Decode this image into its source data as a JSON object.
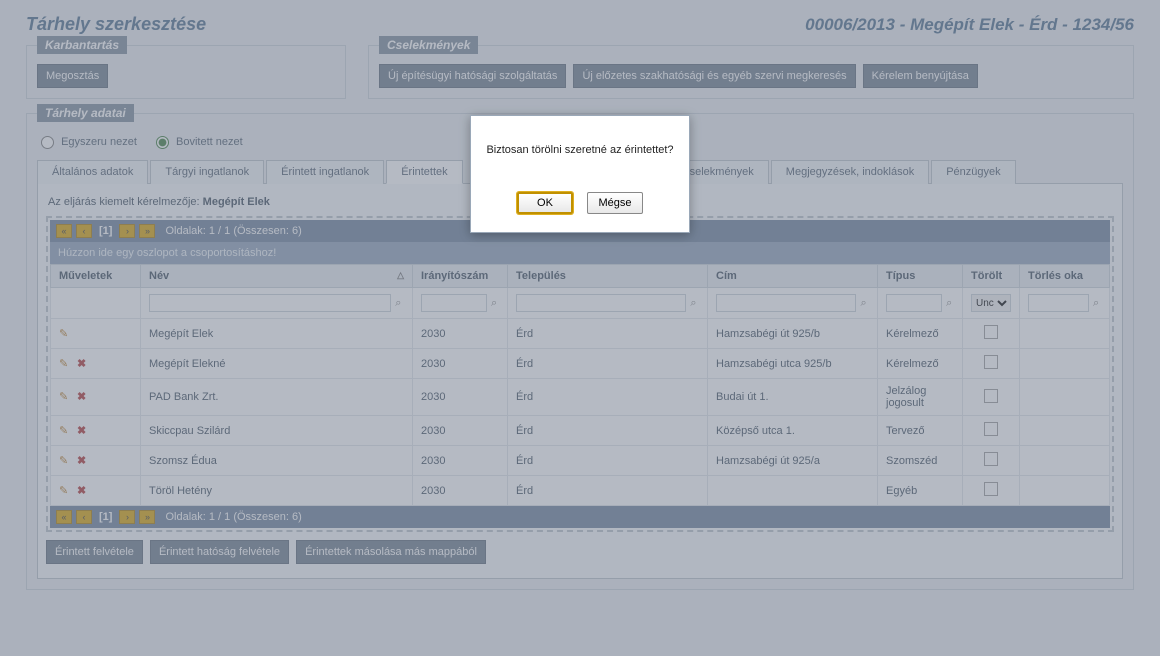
{
  "header": {
    "title": "Tárhely szerkesztése",
    "reference": "00006/2013 - Megépít Elek - Érd - 1234/56"
  },
  "sections": {
    "karbantartas": {
      "legend": "Karbantartás",
      "buttons": {
        "megosztas": "Megosztás"
      }
    },
    "cselekmenyek": {
      "legend": "Cselekmények",
      "buttons": {
        "uj_ep": "Új építésügyi hatósági szolgáltatás",
        "uj_elo": "Új előzetes szakhatósági és egyéb szervi megkeresés",
        "kerelem": "Kérelem benyújtása"
      }
    },
    "tarhely_adatai": {
      "legend": "Tárhely adatai"
    }
  },
  "view": {
    "simple": "Egyszeru nezet",
    "extended": "Bovitett nezet"
  },
  "tabs": {
    "altalanos": "Általános adatok",
    "targyi": "Tárgyi ingatlanok",
    "erintett_ing": "Érintett ingatlanok",
    "erintettek": "Érintettek",
    "cselekmenyek": "Cselekmények",
    "megj": "Megjegyzések, indoklások",
    "penzugyek": "Pénzügyek"
  },
  "kiemelt": {
    "prefix": "Az eljárás kiemelt kérelmezője: ",
    "name": "Megépít Elek"
  },
  "pager": {
    "current": "[1]",
    "text": "Oldalak: 1 / 1 (Összesen: 6)"
  },
  "group_hint": "Húzzon ide egy oszlopot a csoportosításhoz!",
  "columns": {
    "ops": "Műveletek",
    "name": "Név",
    "zip": "Irányítószám",
    "town": "Település",
    "addr": "Cím",
    "type": "Típus",
    "deleted": "Törölt",
    "reason": "Törlés oka"
  },
  "filter": {
    "unc_option": "Unc"
  },
  "rows": [
    {
      "name": "Megépít Elek",
      "zip": "2030",
      "town": "Érd",
      "addr": "Hamzsabégi út 925/b",
      "type": "Kérelmező",
      "has_delete": false
    },
    {
      "name": "Megépít Elekné",
      "zip": "2030",
      "town": "Érd",
      "addr": "Hamzsabégi utca 925/b",
      "type": "Kérelmező",
      "has_delete": true
    },
    {
      "name": "PAD Bank Zrt.",
      "zip": "2030",
      "town": "Érd",
      "addr": "Budai út 1.",
      "type": "Jelzálog jogosult",
      "has_delete": true
    },
    {
      "name": "Skiccpau Szilárd",
      "zip": "2030",
      "town": "Érd",
      "addr": "Középső utca 1.",
      "type": "Tervező",
      "has_delete": true
    },
    {
      "name": "Szomsz Édua",
      "zip": "2030",
      "town": "Érd",
      "addr": "Hamzsabégi út 925/a",
      "type": "Szomszéd",
      "has_delete": true
    },
    {
      "name": "Töröl Hetény",
      "zip": "2030",
      "town": "Érd",
      "addr": "",
      "type": "Egyéb",
      "has_delete": true
    }
  ],
  "bottom_buttons": {
    "add": "Érintett felvétele",
    "add_auth": "Érintett hatóság felvétele",
    "copy": "Érintettek másolása más mappából"
  },
  "dialog": {
    "message": "Biztosan törölni szeretné az érintettet?",
    "ok": "OK",
    "cancel": "Mégse"
  }
}
